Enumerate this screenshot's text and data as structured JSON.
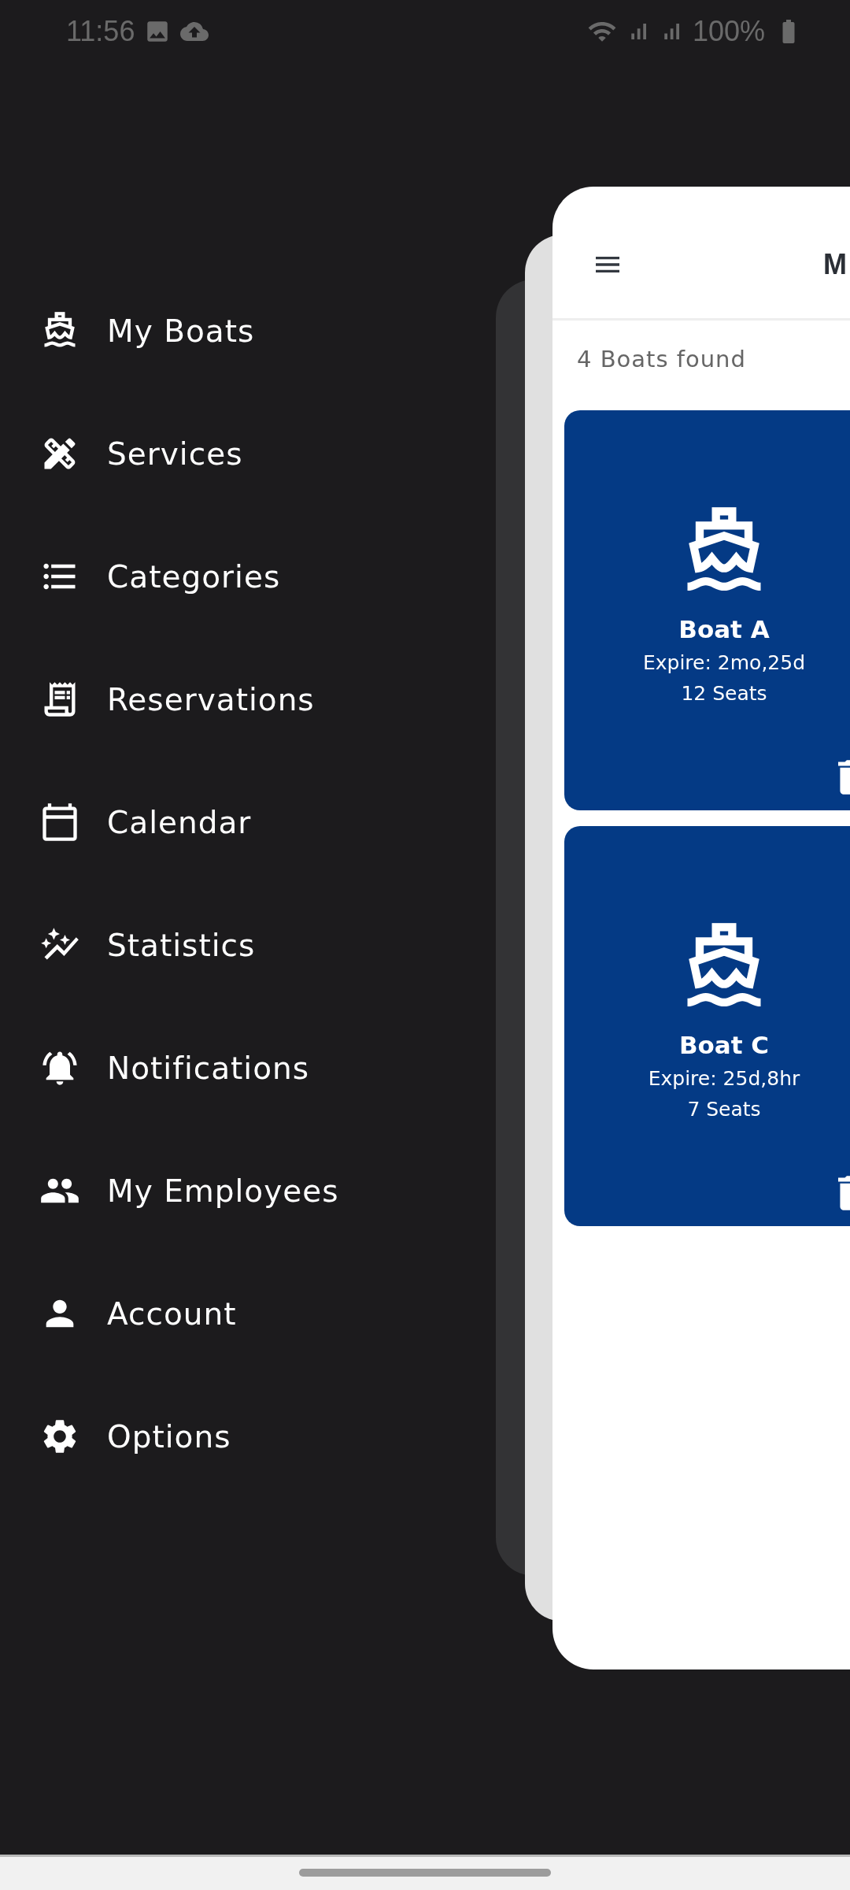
{
  "status_bar": {
    "time": "11:56",
    "battery": "100%"
  },
  "drawer": {
    "items": [
      {
        "label": "My Boats"
      },
      {
        "label": "Services"
      },
      {
        "label": "Categories"
      },
      {
        "label": "Reservations"
      },
      {
        "label": "Calendar"
      },
      {
        "label": "Statistics"
      },
      {
        "label": "Notifications"
      },
      {
        "label": "My Employees"
      },
      {
        "label": "Account"
      },
      {
        "label": "Options"
      }
    ]
  },
  "screen": {
    "header": {
      "title": "M"
    },
    "result_count": "4 Boats found",
    "boats": [
      {
        "name": "Boat A",
        "expire": "Expire: 2mo,25d",
        "seats": "12 Seats"
      },
      {
        "name": "Boat C",
        "expire": "Expire: 25d,8hr",
        "seats": "7 Seats"
      }
    ]
  }
}
